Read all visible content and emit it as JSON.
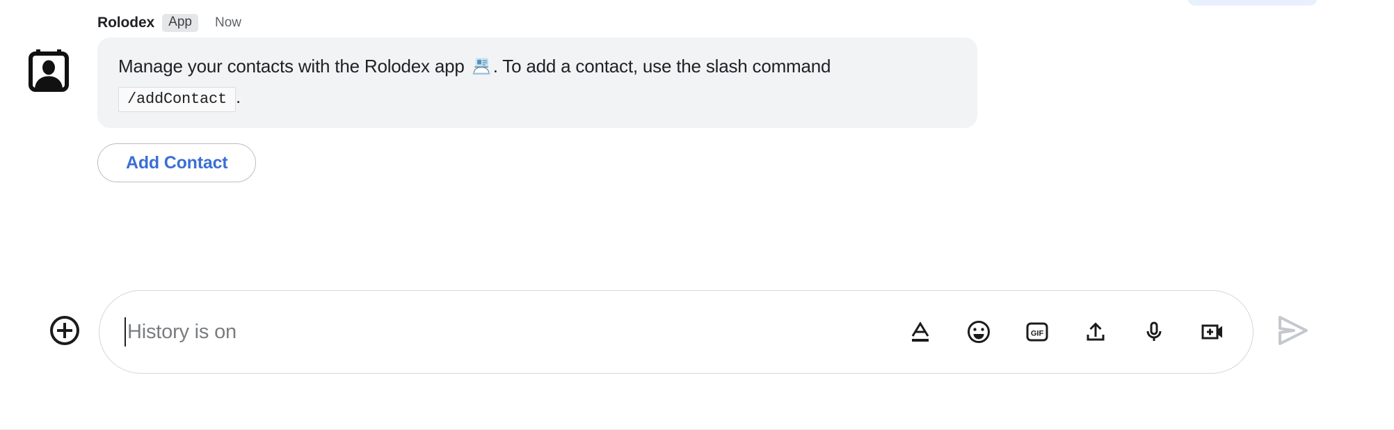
{
  "message": {
    "sender": "Rolodex",
    "badge": "App",
    "timestamp": "Now",
    "avatar_icon": "contact-card-icon",
    "body": {
      "text_before_emoji": "Manage your contacts with the Rolodex app ",
      "emoji": "card-index-emoji",
      "text_after_emoji": ". To add a contact, use the slash command ",
      "code": "/addContact",
      "text_end": "."
    },
    "action_button": {
      "label": "Add Contact",
      "text_color": "#3b6fd4",
      "border_color": "#b9bdc2"
    },
    "bubble_color": "#f1f3f4"
  },
  "composer": {
    "add_button_icon": "plus-circle-icon",
    "input": {
      "value": "",
      "placeholder": "History is on"
    },
    "tools": [
      {
        "name": "format-text-icon",
        "label": "A"
      },
      {
        "name": "emoji-icon",
        "label": ""
      },
      {
        "name": "gif-icon",
        "label": "GIF"
      },
      {
        "name": "upload-file-icon",
        "label": ""
      },
      {
        "name": "microphone-icon",
        "label": ""
      },
      {
        "name": "add-video-icon",
        "label": ""
      }
    ],
    "send_button": {
      "icon": "send-icon",
      "enabled": false,
      "color": "#c4c8ce"
    }
  },
  "top_partial_element": {
    "name": "cut-off-pill",
    "color": "#e8f0fe"
  }
}
